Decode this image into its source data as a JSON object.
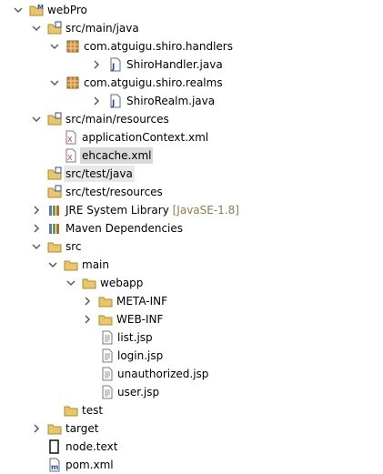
{
  "project": {
    "label": "webPro"
  },
  "nodes": [
    {
      "label": "src/main/java"
    },
    {
      "label": "com.atguigu.shiro.handlers"
    },
    {
      "label": "ShiroHandler.java"
    },
    {
      "label": "com.atguigu.shiro.realms"
    },
    {
      "label": "ShiroRealm.java"
    },
    {
      "label": "src/main/resources"
    },
    {
      "label": "applicationContext.xml"
    },
    {
      "label": "ehcache.xml"
    },
    {
      "label": "src/test/java"
    },
    {
      "label": "src/test/resources"
    },
    {
      "label": "JRE System Library",
      "decoration": "[JavaSE-1.8]"
    },
    {
      "label": "Maven Dependencies"
    },
    {
      "label": "src"
    },
    {
      "label": "main"
    },
    {
      "label": "webapp"
    },
    {
      "label": "META-INF"
    },
    {
      "label": "WEB-INF"
    },
    {
      "label": "list.jsp"
    },
    {
      "label": "login.jsp"
    },
    {
      "label": "unauthorized.jsp"
    },
    {
      "label": "user.jsp"
    },
    {
      "label": "test"
    },
    {
      "label": "target"
    },
    {
      "label": "node.text"
    },
    {
      "label": "pom.xml"
    }
  ]
}
